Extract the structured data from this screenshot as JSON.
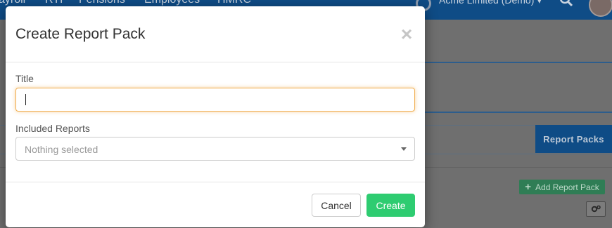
{
  "topnav": {
    "items": [
      "ayroll",
      "RTI",
      "Pensions",
      "Employees",
      "HMRC"
    ],
    "company": "Acme Limited (Demo)",
    "company_caret": "▾"
  },
  "background": {
    "report_packs_tab": "Report Packs",
    "add_report_pack": "Add Report Pack",
    "add_icon": "+",
    "gear_icon": "gear-icon"
  },
  "modal": {
    "title": "Create Report Pack",
    "close": "×",
    "title_label": "Title",
    "title_value": "",
    "included_label": "Included Reports",
    "included_placeholder": "Nothing selected",
    "cancel": "Cancel",
    "create": "Create"
  },
  "colors": {
    "nav": "#0f4c86",
    "create": "#2ecc71",
    "focus": "#f0ad4e"
  }
}
